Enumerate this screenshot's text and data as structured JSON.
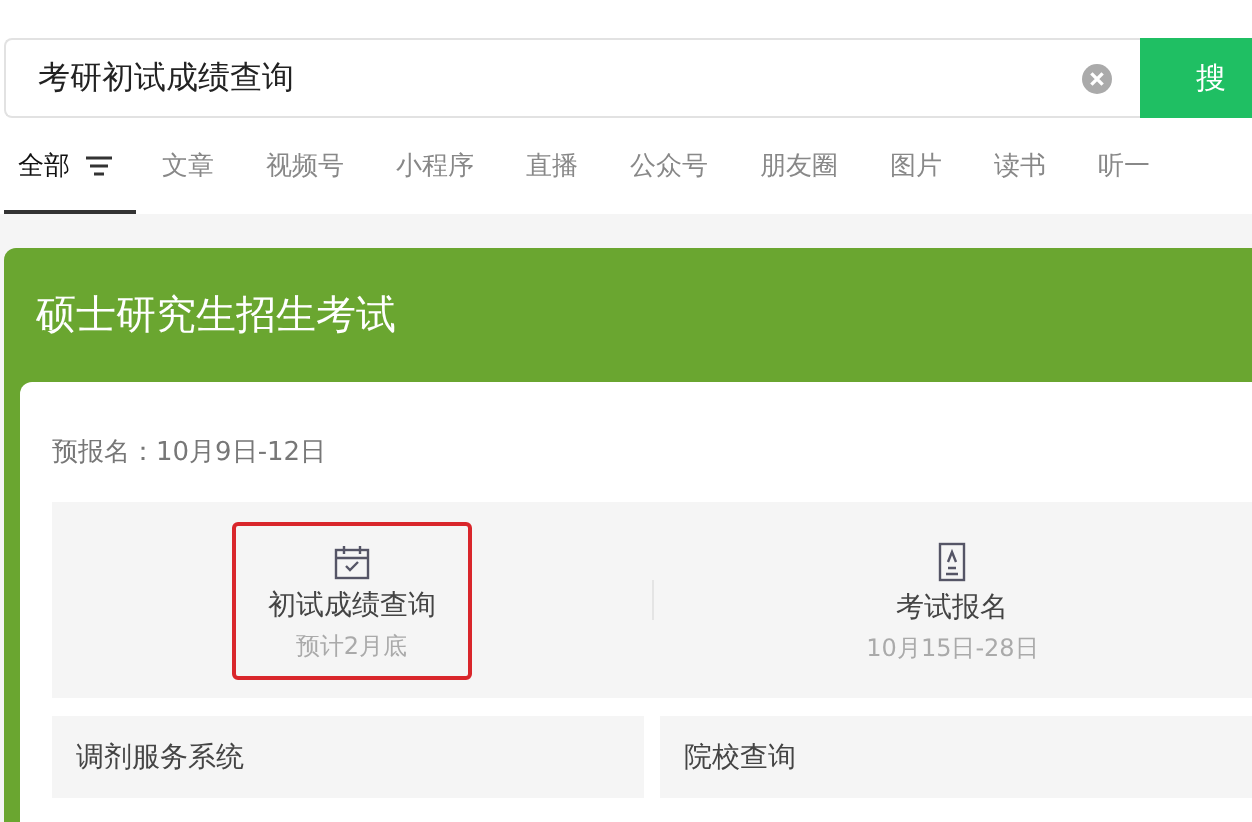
{
  "search": {
    "value": "考研初试成绩查询",
    "button": "搜"
  },
  "tabs": [
    {
      "label": "全部",
      "selected": true,
      "filter": true
    },
    {
      "label": "文章",
      "selected": false
    },
    {
      "label": "视频号",
      "selected": false
    },
    {
      "label": "小程序",
      "selected": false
    },
    {
      "label": "直播",
      "selected": false
    },
    {
      "label": "公众号",
      "selected": false
    },
    {
      "label": "朋友圈",
      "selected": false
    },
    {
      "label": "图片",
      "selected": false
    },
    {
      "label": "读书",
      "selected": false
    },
    {
      "label": "听一",
      "selected": false
    }
  ],
  "card": {
    "title": "硕士研究生招生考试",
    "note": "预报名：10月9日-12日",
    "services": [
      {
        "kind": "calendar",
        "title": "初试成绩查询",
        "subtitle": "预计2月底",
        "highlighted": true
      },
      {
        "kind": "document",
        "title": "考试报名",
        "subtitle": "10月15日-28日",
        "highlighted": false
      }
    ],
    "links": [
      "调剂服务系统",
      "院校查询"
    ]
  }
}
